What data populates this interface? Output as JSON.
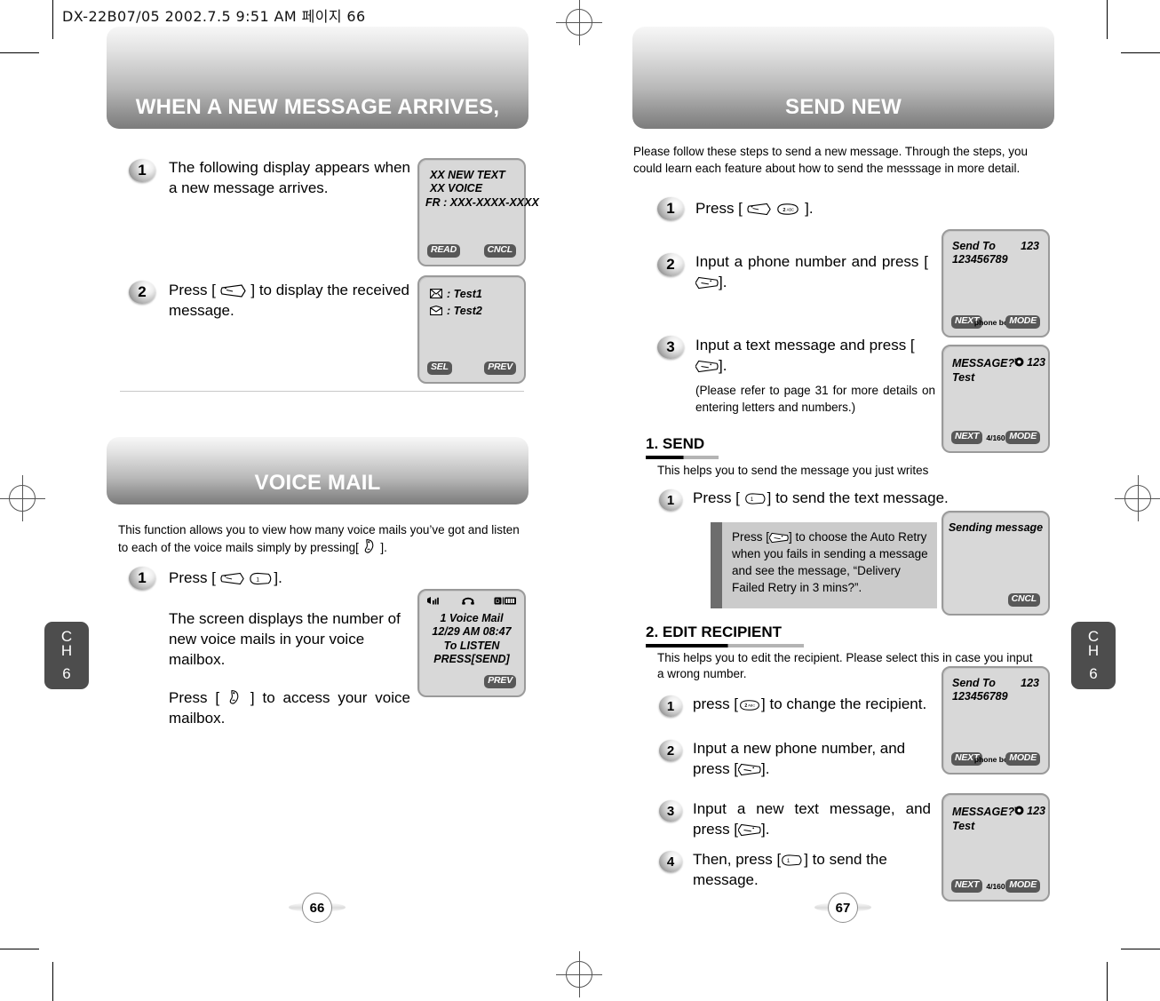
{
  "print_header": "DX-22B07/05  2002.7.5 9:51 AM  페이지 66",
  "chapter_tab": {
    "label": "CH",
    "number": "6"
  },
  "left_page": {
    "page_number": "66",
    "banner_title": "WHEN A NEW MESSAGE ARRIVES,",
    "steps": [
      {
        "num": "1",
        "text_before": "The following display appears when a new message arrives.",
        "key": "",
        "text_after": ""
      },
      {
        "num": "2",
        "text_before": "Press [",
        "key": "msg-key",
        "text_after": "] to display the received message."
      }
    ],
    "screens": [
      {
        "name": "new-message-alert",
        "lines": [
          "XX  NEW TEXT",
          "XX  VOICE",
          "FR : XXX-XXXX-XXXX"
        ],
        "softkey_left": "READ",
        "softkey_right": "CNCL"
      },
      {
        "name": "message-list",
        "lines": [
          ": Test1",
          ": Test2"
        ],
        "softkey_left": "SEL",
        "softkey_right": "PREV"
      }
    ],
    "voice_mail": {
      "banner_title": "VOICE MAIL",
      "intro": "This function allows you to view how many voice mails you've got and listen to each of the voice mails simply by pressing[        ].",
      "step1_num": "1",
      "step1_text": "Press [              ].",
      "para1": "The screen displays the number of new voice mails in your voice mailbox.",
      "para2_before": "Press [",
      "para2_after": "] to access your voice mailbox.",
      "screen": {
        "name": "voice-mail-notice",
        "lines": [
          "1 Voice Mail",
          "12/29 AM 08:47",
          "To LISTEN",
          "PRESS[SEND]"
        ],
        "softkey_right": "PREV"
      }
    }
  },
  "right_page": {
    "page_number": "67",
    "banner_title": "SEND NEW",
    "intro": "Please follow these steps to send a new message. Through the steps, you could learn each feature about how to send the messsage in more detail.",
    "steps": [
      {
        "num": "1",
        "text_before": "Press [",
        "text_after": "].",
        "keys": [
          "msg-key",
          "2abc-key"
        ]
      },
      {
        "num": "2",
        "text_before": "Input a phone number and press [",
        "text_after": "]."
      },
      {
        "num": "3",
        "text_before": "Input a text message and press [",
        "text_after": "]."
      }
    ],
    "step3_note": "(Please refer to page 31 for more details on entering letters and numbers.)",
    "screens": [
      {
        "name": "send-to",
        "title": "Send To",
        "indicator": "123",
        "value": "123456789",
        "softkey_left": "NEXT",
        "softkey_mid": "phone book",
        "softkey_right": "MODE"
      },
      {
        "name": "message-compose",
        "title": "MESSAGE?",
        "indicator": "123",
        "value": "Test",
        "softkey_left": "NEXT",
        "softkey_mid": "4/160",
        "softkey_right": "MODE"
      },
      {
        "name": "sending-message",
        "title": "Sending message",
        "softkey_right": "CNCL"
      },
      {
        "name": "send-to-edit",
        "title": "Send To",
        "indicator": "123",
        "value": "123456789",
        "softkey_left": "NEXT",
        "softkey_mid": "phone book",
        "softkey_right": "MODE"
      },
      {
        "name": "message-compose-edit",
        "title": "MESSAGE?",
        "indicator": "123",
        "value": "Test",
        "softkey_left": "NEXT",
        "softkey_mid": "4/160",
        "softkey_right": "MODE"
      }
    ],
    "section_send": {
      "heading": "1. SEND",
      "sub": "This helps you to send the message you just writes",
      "step_num": "1",
      "step_before": "Press [",
      "step_after": "] to send the text message.",
      "tip_before": "Press [",
      "tip_after": "] to choose the Auto Retry when you fails in sending a message and see the message, “Delivery Failed Retry in 3 mins?”."
    },
    "section_edit": {
      "heading": "2. EDIT RECIPIENT",
      "sub": "This helps you to edit the recipient. Please select this in case you input a wrong number.",
      "steps": [
        {
          "num": "1",
          "before": "press [",
          "after": "] to change the recipient."
        },
        {
          "num": "2",
          "before": "Input a new phone number, and press [",
          "after": "]."
        },
        {
          "num": "3",
          "before": "Input a new text message, and press [",
          "after": "]."
        },
        {
          "num": "4",
          "before": "Then, press [",
          "after": "] to send the message."
        }
      ]
    }
  },
  "colors": {
    "banner_dark": "#7c7c7c",
    "tab_gray": "#4d4d4d",
    "lcd_bg": "#d8d8d8",
    "softkey_bg": "#585858",
    "tip_bg": "#cbcbcb"
  }
}
